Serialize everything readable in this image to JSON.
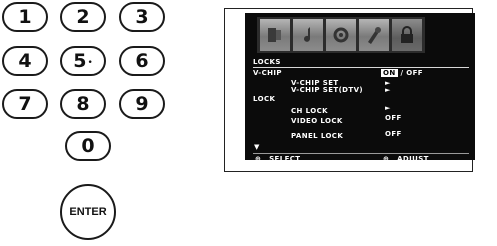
{
  "keypad": {
    "keys": [
      "1",
      "2",
      "3",
      "4",
      "5",
      "6",
      "7",
      "8",
      "9",
      "0"
    ],
    "key5_mark": "•",
    "enter_label": "ENTER"
  },
  "menu": {
    "header": "LOCKS",
    "items": {
      "vchip": "V-CHIP",
      "on": "ON",
      "slash_off": "/ OFF",
      "vchip_set": "V-CHIP SET",
      "vchip_set_arrow": "►",
      "vchip_set_dtv": "V-CHIP SET(DTV)",
      "vchip_set_dtv_arrow": "►",
      "lock": "LOCK",
      "ch_lock": "CH LOCK",
      "ch_lock_arrow": "►",
      "video_lock": "VIDEO LOCK",
      "video_lock_value": "OFF",
      "panel_lock": "PANEL LOCK",
      "panel_lock_value": "OFF",
      "more_arrow": "▼"
    },
    "footer": {
      "select_icon": "⊕",
      "select": "SELECT",
      "adjust_icon": "⊕",
      "adjust": "ADJUST"
    },
    "icon_names": [
      "picture-icon",
      "audio-icon",
      "setup-icon",
      "features-icon",
      "locks-icon"
    ]
  }
}
